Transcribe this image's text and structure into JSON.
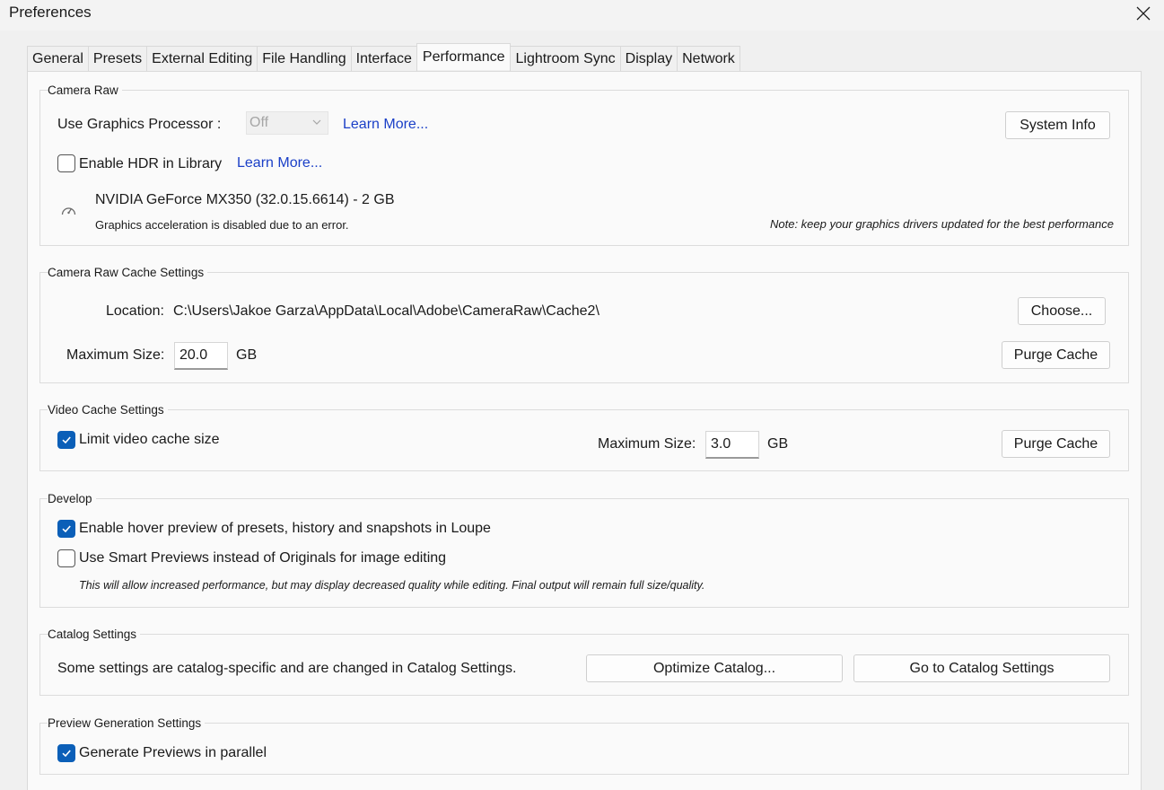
{
  "window": {
    "title": "Preferences"
  },
  "tabs": [
    {
      "label": "General"
    },
    {
      "label": "Presets"
    },
    {
      "label": "External Editing"
    },
    {
      "label": "File Handling"
    },
    {
      "label": "Interface"
    },
    {
      "label": "Performance"
    },
    {
      "label": "Lightroom Sync"
    },
    {
      "label": "Display"
    },
    {
      "label": "Network"
    }
  ],
  "active_tab": "Performance",
  "camera_raw": {
    "title": "Camera Raw",
    "gpu_label": "Use Graphics Processor :",
    "gpu_value": "Off",
    "learn_more": "Learn More...",
    "system_info": "System Info",
    "hdr_label": "Enable HDR in Library",
    "hdr_checked": false,
    "hdr_learn_more": "Learn More...",
    "gpu_name": "NVIDIA GeForce MX350 (32.0.15.6614) - 2 GB",
    "gpu_status": "Graphics acceleration is disabled due to an error.",
    "note": "Note: keep your graphics drivers updated for the best performance",
    "icon": "speedometer-icon"
  },
  "cache": {
    "title": "Camera Raw Cache Settings",
    "location_label": "Location:",
    "location_value": "C:\\Users\\Jakoe Garza\\AppData\\Local\\Adobe\\CameraRaw\\Cache2\\",
    "choose": "Choose...",
    "max_label": "Maximum Size:",
    "max_value": "20.0",
    "unit": "GB",
    "purge": "Purge Cache"
  },
  "video": {
    "title": "Video Cache Settings",
    "limit_label": "Limit video cache size",
    "limit_checked": true,
    "max_label": "Maximum Size:",
    "max_value": "3.0",
    "unit": "GB",
    "purge": "Purge Cache"
  },
  "develop": {
    "title": "Develop",
    "hover_label": "Enable hover preview of presets, history and snapshots in Loupe",
    "hover_checked": true,
    "smart_label": "Use Smart Previews instead of Originals for image editing",
    "smart_checked": false,
    "smart_note": "This will allow increased performance, but may display decreased quality while editing. Final output will remain full size/quality."
  },
  "catalog": {
    "title": "Catalog Settings",
    "text": "Some settings are catalog-specific and are changed in Catalog Settings.",
    "optimize": "Optimize Catalog...",
    "goto": "Go to Catalog Settings"
  },
  "preview": {
    "title": "Preview Generation Settings",
    "parallel_label": "Generate Previews in parallel",
    "parallel_checked": true
  },
  "colors": {
    "accent": "#0b5fb8",
    "link": "#1a3fc7"
  }
}
